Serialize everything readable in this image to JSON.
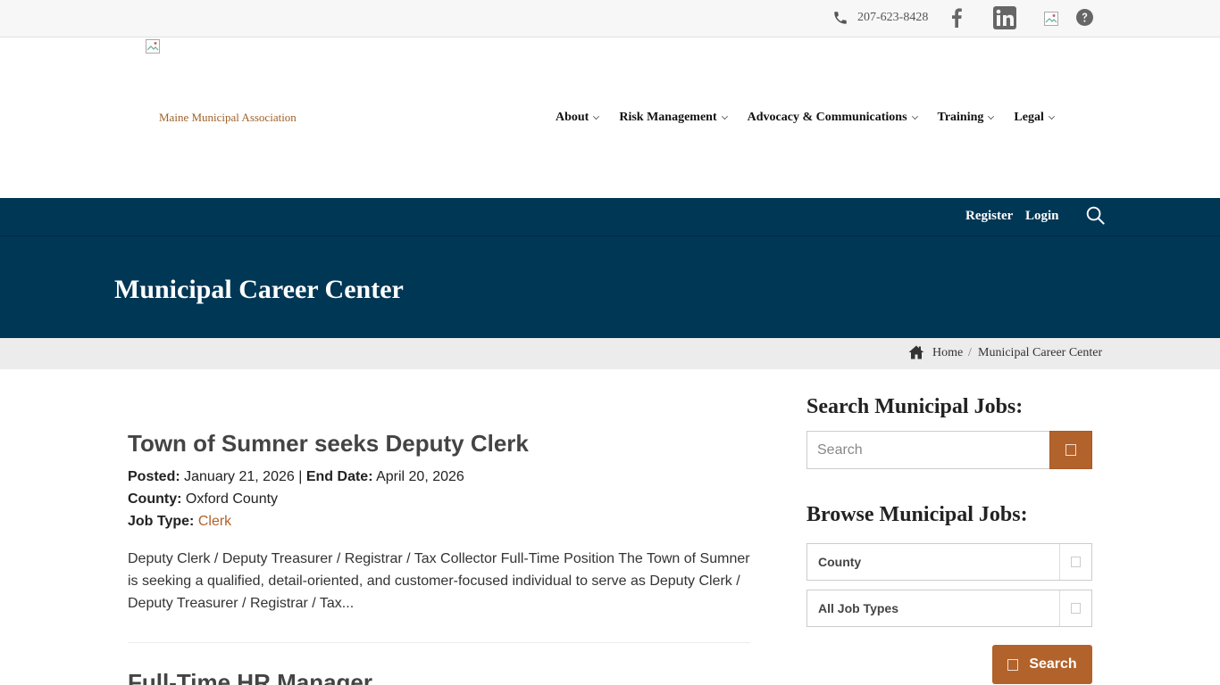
{
  "topbar": {
    "phone": "207-623-8428",
    "icons": [
      "phone-icon",
      "facebook-icon",
      "linkedin-icon",
      "broken-image-icon",
      "help-icon"
    ]
  },
  "header": {
    "logo_text": "Maine Municipal Association",
    "nav": [
      {
        "label": "About"
      },
      {
        "label": "Risk Management"
      },
      {
        "label": "Advocacy & Communications"
      },
      {
        "label": "Training"
      },
      {
        "label": "Legal"
      }
    ]
  },
  "band": {
    "register": "Register",
    "login": "Login",
    "title": "Municipal Career Center"
  },
  "breadcrumb": {
    "home": "Home",
    "separator": "/",
    "current": "Municipal Career Center"
  },
  "jobs": [
    {
      "title": "Town of Sumner seeks Deputy Clerk",
      "posted_label": "Posted:",
      "posted": "January 21, 2026",
      "pipe": "|",
      "end_label": "End Date:",
      "end": "April 20, 2026",
      "county_label": "County:",
      "county": "Oxford County",
      "type_label": "Job Type:",
      "type": "Clerk",
      "description": "Deputy Clerk / Deputy Treasurer / Registrar / Tax Collector   Full-Time Position The Town of Sumner is seeking a qualified, detail-oriented, and customer-focused individual to serve as Deputy Clerk / Deputy Treasurer / Registrar / Tax..."
    },
    {
      "title": "Full-Time HR Manager"
    }
  ],
  "sidebar": {
    "search_heading": "Search Municipal Jobs:",
    "search_placeholder": "Search",
    "browse_heading": "Browse Municipal Jobs:",
    "county_select": "County",
    "type_select": "All Job Types",
    "search_button": "Search"
  },
  "colors": {
    "brand_blue": "#003755",
    "accent": "#b2622b"
  }
}
